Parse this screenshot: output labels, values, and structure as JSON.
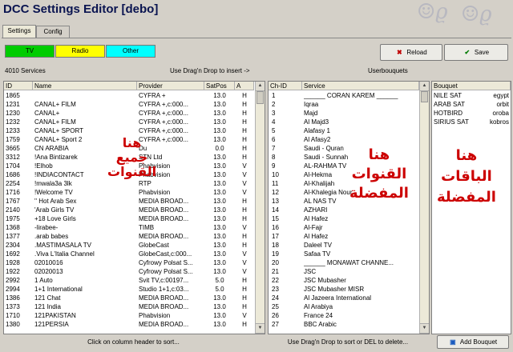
{
  "window": {
    "title": "DCC Settings Editor [debo]"
  },
  "tabs": [
    {
      "label": "Settings",
      "active": true
    },
    {
      "label": "Config",
      "active": false
    }
  ],
  "filters": [
    {
      "label": "TV",
      "color": "#00cc00"
    },
    {
      "label": "Radio",
      "color": "#ffff00"
    },
    {
      "label": "Other",
      "color": "#00ffff"
    }
  ],
  "toolbar": {
    "reload_label": "Reload",
    "save_label": "Save"
  },
  "services": {
    "count_label": "4010 Services",
    "drag_hint": "Use Drag'n Drop to insert ->",
    "columns": [
      "ID",
      "Name",
      "Provider",
      "SatPos",
      "A"
    ],
    "rows": [
      [
        "1865",
        "",
        "CYFRA +",
        "13.0",
        "H"
      ],
      [
        "1231",
        "  CANAL+ FILM",
        "CYFRA +,c:000...",
        "13.0",
        "H"
      ],
      [
        "1230",
        "  CANAL+",
        "CYFRA +,c:000...",
        "13.0",
        "H"
      ],
      [
        "1232",
        "  CANAL+ FILM",
        "CYFRA +,c:000...",
        "13.0",
        "H"
      ],
      [
        "1233",
        "  CANAL+ SPORT",
        "CYFRA +,c:000...",
        "13.0",
        "H"
      ],
      [
        "1759",
        "  CANAL+ Sport 2",
        "CYFRA +,c:000...",
        "13.0",
        "H"
      ],
      [
        "3665",
        "  CN ARABIA",
        "Du",
        "0.0",
        "H"
      ],
      [
        "3312",
        "!Ana Bintizarek",
        "STN Ltd",
        "13.0",
        "H"
      ],
      [
        "1704",
        "!Elhob",
        "Phabvision",
        "13.0",
        "V"
      ],
      [
        "1686",
        "!INDIACONTACT",
        "Phabvision",
        "13.0",
        "V"
      ],
      [
        "2254",
        "!mwala3a 3lk",
        "RTP",
        "13.0",
        "V"
      ],
      [
        "1716",
        "!Welcome TV",
        "Phabvision",
        "13.0",
        "V"
      ],
      [
        "1767",
        "'' Hot Arab Sex",
        "MEDIA BROAD...",
        "13.0",
        "H"
      ],
      [
        "2140",
        "'Arab Girls TV",
        "MEDIA BROAD...",
        "13.0",
        "H"
      ],
      [
        "1975",
        "+18 Love Girls",
        "MEDIA BROAD...",
        "13.0",
        "H"
      ],
      [
        "1368",
        "-lirabee-",
        "TIMB",
        "13.0",
        "V"
      ],
      [
        "1377",
        ".arab babes",
        "MEDIA BROAD...",
        "13.0",
        "H"
      ],
      [
        "2304",
        ".MASTIMASALA TV",
        "GlobeCast",
        "13.0",
        "H"
      ],
      [
        "1692",
        ".Viva L'Italia Channel",
        "GlobeCast,c:000...",
        "13.0",
        "V"
      ],
      [
        "1928",
        "02010016",
        "Cyfrowy Polsat S...",
        "13.0",
        "V"
      ],
      [
        "1922",
        "02020013",
        "Cyfrowy Polsat S...",
        "13.0",
        "V"
      ],
      [
        "2992",
        "1 Auto",
        "Svit TV,c:00197...",
        "5.0",
        "H"
      ],
      [
        "2994",
        "1+1 International",
        "Studio 1+1,c:03...",
        "5.0",
        "H"
      ],
      [
        "1386",
        "121 Chat",
        "MEDIA BROAD...",
        "13.0",
        "H"
      ],
      [
        "1373",
        "121 India",
        "MEDIA BROAD...",
        "13.0",
        "H"
      ],
      [
        "1710",
        "121PAKISTAN",
        "Phabvision",
        "13.0",
        "V"
      ],
      [
        "1380",
        "121PERSIA",
        "MEDIA BROAD...",
        "13.0",
        "H"
      ]
    ],
    "status": "Click on column header to sort..."
  },
  "userbouquets": {
    "header": "Userbouquets",
    "columns": [
      "Ch-ID",
      "Service"
    ],
    "rows": [
      [
        "1",
        "______ CORAN KAREM ______"
      ],
      [
        "2",
        "Iqraa"
      ],
      [
        "3",
        "Majd"
      ],
      [
        "4",
        "Al Majd3"
      ],
      [
        "5",
        "Alafasy 1"
      ],
      [
        "6",
        "Al Afasy2"
      ],
      [
        "7",
        "Saudi - Quran"
      ],
      [
        "8",
        "Saudi - Sunnah"
      ],
      [
        "9",
        "AL-RAHMA TV"
      ],
      [
        "10",
        "Al-Hekma"
      ],
      [
        "11",
        "Al-Khalijah"
      ],
      [
        "12",
        "Al-Khalegia Nour"
      ],
      [
        "13",
        "AL NAS TV"
      ],
      [
        "14",
        "AZHARI"
      ],
      [
        "15",
        "Al Hafez"
      ],
      [
        "16",
        "Al-Fajr"
      ],
      [
        "17",
        "Al Hafez"
      ],
      [
        "18",
        "Daleel TV"
      ],
      [
        "19",
        "Safaa TV"
      ],
      [
        "20",
        "______ MONAWAT CHANNE..."
      ],
      [
        "21",
        "JSC"
      ],
      [
        "22",
        "JSC Mubasher"
      ],
      [
        "23",
        "JSC Mubasher MISR"
      ],
      [
        "24",
        "Al Jazeera International"
      ],
      [
        "25",
        "Al Arabiya"
      ],
      [
        "26",
        "France 24"
      ],
      [
        "27",
        "BBC Arabic"
      ]
    ],
    "status": "Use Drag'n Drop to sort or DEL to delete..."
  },
  "bouquets": {
    "columns": [
      "Bouquet"
    ],
    "rows": [
      [
        "NILE SAT",
        "egypt"
      ],
      [
        "ARAB SAT",
        "orbit"
      ],
      [
        "HOTBIRD",
        "oroba"
      ],
      [
        "SIRIUS SAT",
        "kobros"
      ]
    ],
    "add_label": "Add Bouquet"
  },
  "annotations": {
    "left": [
      "هنا",
      "جميع",
      "القنوات"
    ],
    "middle": [
      "هنا",
      "القنوات",
      "المفضلة"
    ],
    "right": [
      "هنا",
      "الباقات",
      "المفضلة"
    ]
  },
  "icons": {
    "reload": "x-icon",
    "save": "check-icon",
    "add": "add-icon"
  }
}
